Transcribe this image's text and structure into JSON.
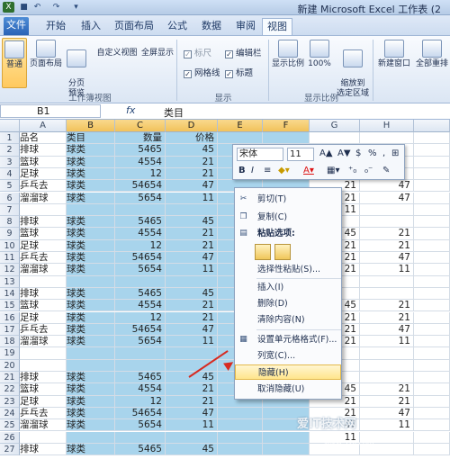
{
  "window": {
    "title": "新建 Microsoft Excel 工作表 (2"
  },
  "tabs": [
    "文件",
    "开始",
    "插入",
    "页面布局",
    "公式",
    "数据",
    "审阅",
    "视图"
  ],
  "ribbon": {
    "views": [
      "普通",
      "页面布局",
      "分页\n预览",
      "自定义视图",
      "全屏显示"
    ],
    "views_group": "工作簿视图",
    "show": {
      "ruler": "标尺",
      "formula_bar": "编辑栏",
      "gridlines": "网格线",
      "headings": "标题"
    },
    "show_group": "显示",
    "zoom": [
      "显示比例",
      "100%",
      "缩放到\n选定区域"
    ],
    "zoom_group": "显示比例",
    "window": [
      "新建窗口",
      "全部重排"
    ]
  },
  "formula_bar": {
    "name_box": "B1",
    "fx": "fx",
    "value": "类目"
  },
  "columns": [
    "A",
    "B",
    "C",
    "D",
    "E",
    "F",
    "G",
    "H"
  ],
  "header_row": {
    "a": "品名",
    "b": "类目",
    "c": "数量",
    "d": "价格"
  },
  "rows": [
    {
      "n": "1",
      "a": "品名",
      "b": "类目",
      "c": "数量",
      "d": "价格",
      "g": "",
      "h": ""
    },
    {
      "n": "2",
      "a": "排球",
      "b": "球类",
      "c": "5465",
      "d": "45",
      "g": "",
      "h": ""
    },
    {
      "n": "3",
      "a": "篮球",
      "b": "球类",
      "c": "4554",
      "d": "21",
      "g": "",
      "h": ""
    },
    {
      "n": "4",
      "a": "足球",
      "b": "球类",
      "c": "12",
      "d": "21",
      "g": "",
      "h": ""
    },
    {
      "n": "5",
      "a": "乒乓去",
      "b": "球类",
      "c": "54654",
      "d": "47",
      "g": "21",
      "h": "47"
    },
    {
      "n": "6",
      "a": "溜溜球",
      "b": "球类",
      "c": "5654",
      "d": "11",
      "g": "21",
      "h": "47"
    },
    {
      "n": "7",
      "a": "",
      "b": "",
      "c": "",
      "d": "",
      "g": "11",
      "h": ""
    },
    {
      "n": "8",
      "a": "排球",
      "b": "球类",
      "c": "5465",
      "d": "45",
      "g": "",
      "h": ""
    },
    {
      "n": "9",
      "a": "篮球",
      "b": "球类",
      "c": "4554",
      "d": "21",
      "g": "45",
      "h": "21"
    },
    {
      "n": "10",
      "a": "足球",
      "b": "球类",
      "c": "12",
      "d": "21",
      "g": "21",
      "h": "21"
    },
    {
      "n": "11",
      "a": "乒乓去",
      "b": "球类",
      "c": "54654",
      "d": "47",
      "g": "21",
      "h": "47"
    },
    {
      "n": "12",
      "a": "溜溜球",
      "b": "球类",
      "c": "5654",
      "d": "11",
      "g": "21",
      "h": "11"
    },
    {
      "n": "13",
      "a": "",
      "b": "",
      "c": "",
      "d": "",
      "g": "",
      "h": ""
    },
    {
      "n": "14",
      "a": "排球",
      "b": "球类",
      "c": "5465",
      "d": "45",
      "g": "",
      "h": ""
    },
    {
      "n": "15",
      "a": "篮球",
      "b": "球类",
      "c": "4554",
      "d": "21",
      "g": "45",
      "h": "21"
    },
    {
      "n": "16",
      "a": "足球",
      "b": "球类",
      "c": "12",
      "d": "21",
      "g": "21",
      "h": "21"
    },
    {
      "n": "17",
      "a": "乒乓去",
      "b": "球类",
      "c": "54654",
      "d": "47",
      "g": "21",
      "h": "47"
    },
    {
      "n": "18",
      "a": "溜溜球",
      "b": "球类",
      "c": "5654",
      "d": "11",
      "g": "21",
      "h": "11"
    },
    {
      "n": "19",
      "a": "",
      "b": "",
      "c": "",
      "d": "",
      "g": "",
      "h": ""
    },
    {
      "n": "20",
      "a": "",
      "b": "",
      "c": "",
      "d": "",
      "g": "",
      "h": ""
    },
    {
      "n": "21",
      "a": "排球",
      "b": "球类",
      "c": "5465",
      "d": "45",
      "g": "",
      "h": ""
    },
    {
      "n": "22",
      "a": "篮球",
      "b": "球类",
      "c": "4554",
      "d": "21",
      "g": "45",
      "h": "21"
    },
    {
      "n": "23",
      "a": "足球",
      "b": "球类",
      "c": "12",
      "d": "21",
      "g": "21",
      "h": "21"
    },
    {
      "n": "24",
      "a": "乒乓去",
      "b": "球类",
      "c": "54654",
      "d": "47",
      "g": "21",
      "h": "47"
    },
    {
      "n": "25",
      "a": "溜溜球",
      "b": "球类",
      "c": "5654",
      "d": "11",
      "g": "47",
      "h": "11"
    },
    {
      "n": "26",
      "a": "",
      "b": "",
      "c": "",
      "d": "",
      "g": "11",
      "h": ""
    },
    {
      "n": "27",
      "a": "排球",
      "b": "球类",
      "c": "5465",
      "d": "45",
      "g": "",
      "h": ""
    }
  ],
  "mini_toolbar": {
    "font": "宋体",
    "size": "11",
    "percent": "%",
    "comma": ","
  },
  "context_menu": {
    "cut": "剪切(T)",
    "copy": "复制(C)",
    "paste_options": "粘贴选项:",
    "paste_special": "选择性粘贴(S)...",
    "insert": "插入(I)",
    "delete": "删除(D)",
    "clear": "清除内容(N)",
    "format": "设置单元格格式(F)...",
    "width": "列宽(C)...",
    "hide": "隐藏(H)",
    "unhide": "取消隐藏(U)"
  },
  "watermark": {
    "main": "爱IT技术网",
    "url": "www.52ij.com"
  },
  "colors": {
    "selection": "#a8d4ec",
    "highlight": "#ffe58c",
    "arrow": "#d72a20"
  }
}
